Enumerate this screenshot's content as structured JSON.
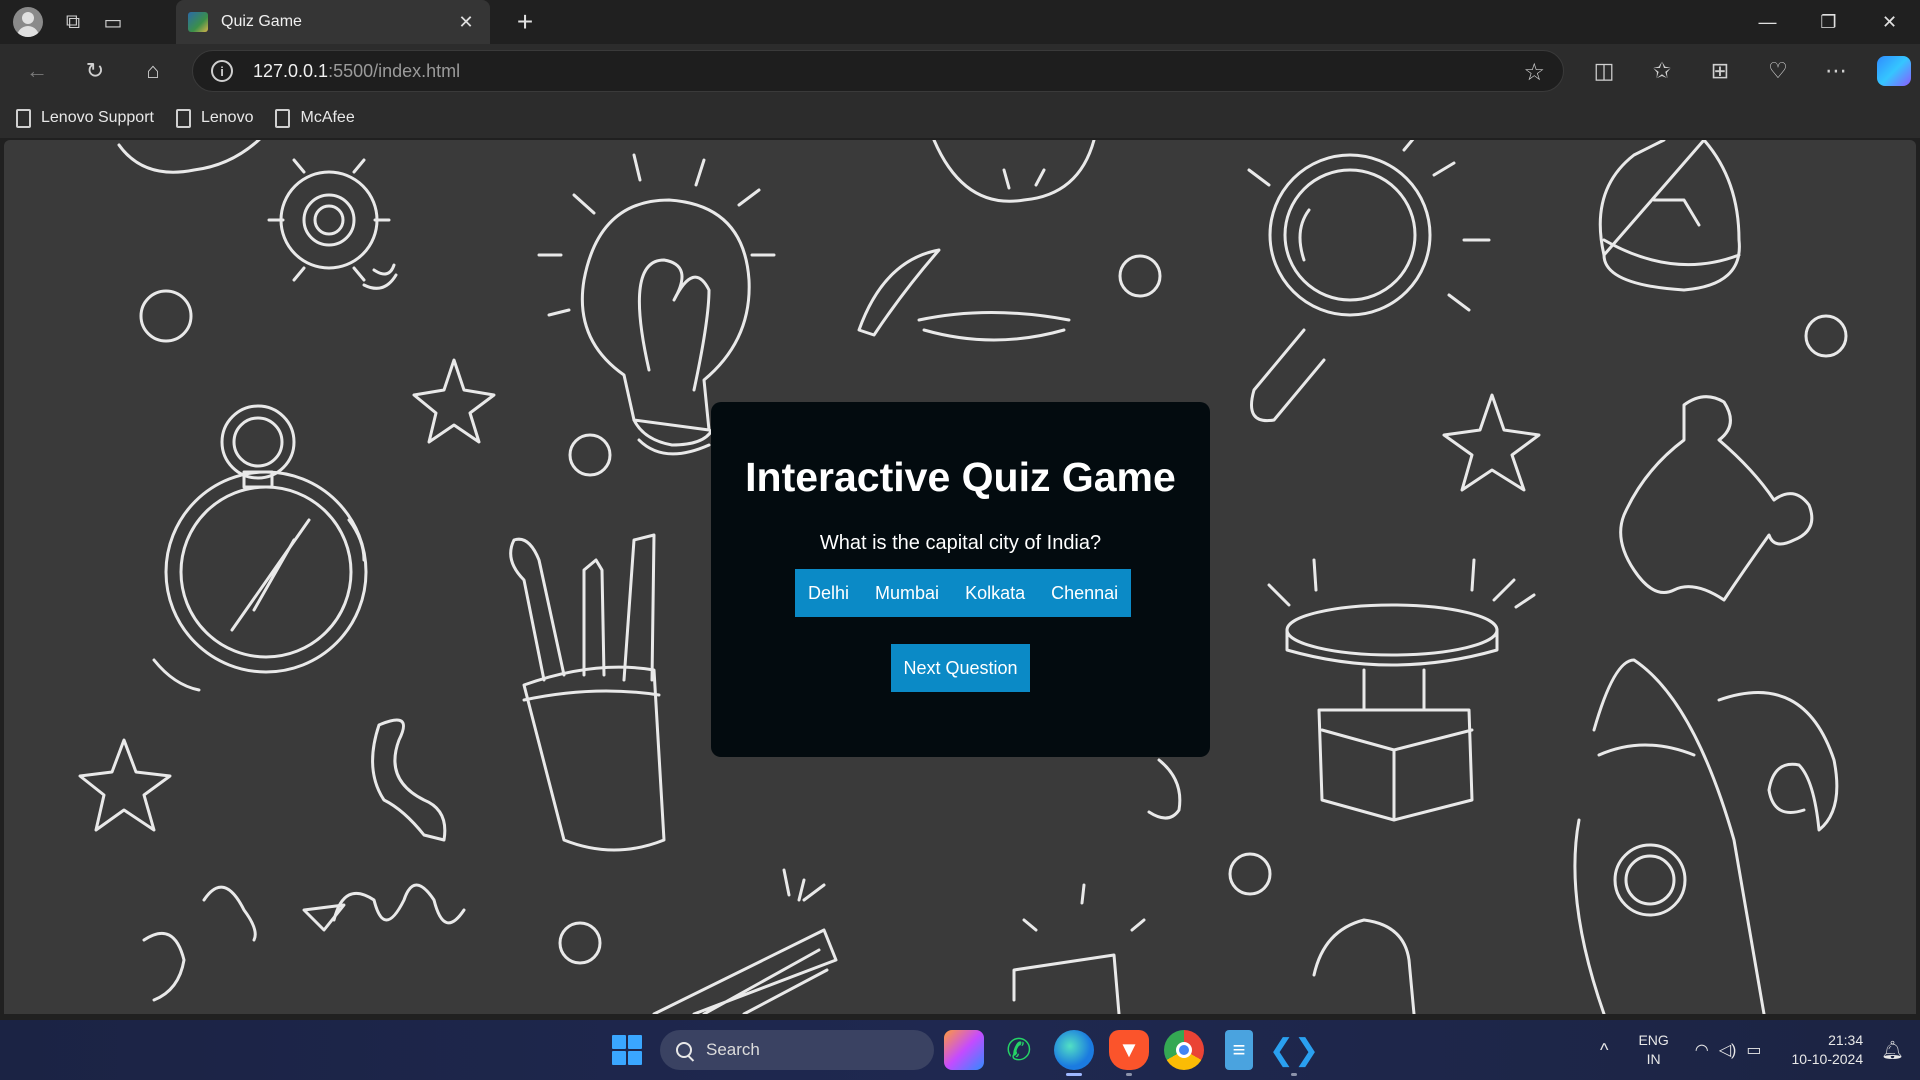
{
  "browser": {
    "tab_title": "Quiz Game",
    "url_host": "127.0.0.1",
    "url_path": ":5500/index.html",
    "bookmarks": [
      "Lenovo Support",
      "Lenovo",
      "McAfee"
    ]
  },
  "quiz": {
    "title": "Interactive Quiz Game",
    "question": "What is the capital city of India?",
    "answers": [
      "Delhi",
      "Mumbai",
      "Kolkata",
      "Chennai"
    ],
    "next_label": "Next Question"
  },
  "taskbar": {
    "search_label": "Search",
    "language": "ENG",
    "region": "IN",
    "time": "21:34",
    "date": "10-10-2024"
  },
  "colors": {
    "accent": "#0b8ac6",
    "card_background": "#030b0f",
    "page_background": "#3a3a3a"
  }
}
